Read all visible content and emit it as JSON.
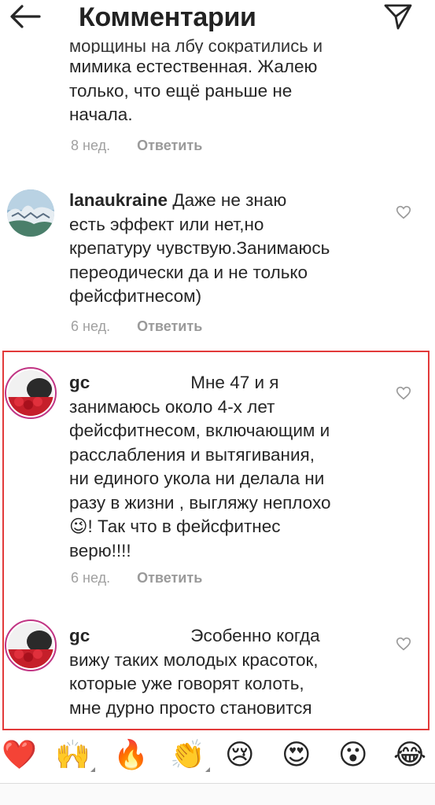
{
  "header": {
    "title": "Комментарии",
    "back_icon": "arrow-left-icon",
    "send_icon": "paper-plane-icon"
  },
  "top_comment": {
    "partial_line": "морщины на лбу сократились и",
    "lines": [
      "мимика естественная. Жалею",
      "только, что ещё раньше не",
      "начала."
    ],
    "time": "8 нед.",
    "reply": "Ответить"
  },
  "comment_lana": {
    "username": "lanaukraine",
    "lines": [
      "Даже не знаю",
      "есть эффект или нет,но",
      "крепатуру чувствую.Занимаюсь",
      "переодически да и не только",
      "фейсфитнесом)"
    ],
    "time": "6 нед.",
    "reply": "Ответить"
  },
  "comment_go1": {
    "username": "gc",
    "lines": [
      "Мне 47 и я",
      "занимаюсь  около 4-х лет",
      "фейсфитнесом, включающим и",
      "расслабления и вытягивания,",
      "ни единого укола ни делала ни",
      "разу в жизни ,  выгляжу неплохо",
      "! Так что в фейсфитнес",
      "верю!!!!"
    ],
    "emoji": "😉",
    "time": "6 нед.",
    "reply": "Ответить"
  },
  "comment_go2": {
    "username": "gc",
    "lines": [
      "Эсобенно когда",
      "вижу таких молодых красоток,",
      "которые уже говорят колоть,",
      "мне дурно просто становится"
    ]
  },
  "emoji_bar": {
    "items": [
      {
        "char": "❤️",
        "name": "heart-emoji",
        "has_variants": false
      },
      {
        "char": "🙌",
        "name": "raising-hands-emoji",
        "has_variants": true
      },
      {
        "char": "🔥",
        "name": "fire-emoji",
        "has_variants": false
      },
      {
        "char": "👏",
        "name": "clapping-hands-emoji",
        "has_variants": true
      },
      {
        "char": "😢",
        "name": "crying-face-emoji",
        "has_variants": false
      },
      {
        "char": "😍",
        "name": "heart-eyes-emoji",
        "has_variants": false
      },
      {
        "char": "😮",
        "name": "surprised-face-emoji",
        "has_variants": false
      },
      {
        "char": "😂",
        "name": "tears-of-joy-emoji",
        "has_variants": false
      }
    ]
  },
  "colors": {
    "highlight_border": "#e23a3a",
    "story_ring": "#c13584",
    "meta_text": "#a0a0a0"
  }
}
